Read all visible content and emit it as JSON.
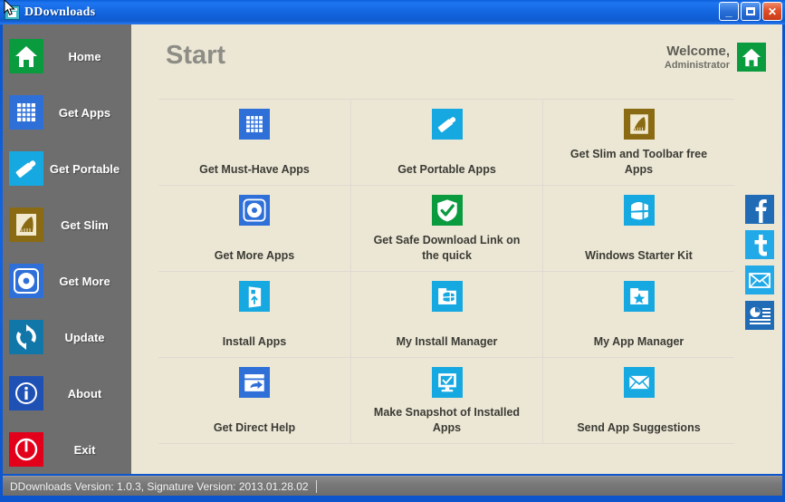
{
  "window": {
    "title": "DDownloads",
    "app_icon": "app-window-icon",
    "controls": [
      {
        "name": "minimize-button",
        "glyph": "_"
      },
      {
        "name": "maximize-button",
        "glyph": "□"
      },
      {
        "name": "close-button",
        "glyph": "✕"
      }
    ]
  },
  "sidebar": {
    "items": [
      {
        "label": "Home",
        "icon": "home-icon",
        "color": "#0a9b3f"
      },
      {
        "label": "Get Apps",
        "icon": "grid-apps-icon",
        "color": "#2f6fd8"
      },
      {
        "label": "Get Portable",
        "icon": "usb-stick-icon",
        "color": "#16a8e0"
      },
      {
        "label": "Get Slim",
        "icon": "slim-broom-icon",
        "color": "#8a6a12"
      },
      {
        "label": "Get More",
        "icon": "disc-icon",
        "color": "#2f6fd8"
      },
      {
        "label": "Update",
        "icon": "refresh-icon",
        "color": "#1176a8"
      },
      {
        "label": "About",
        "icon": "info-icon",
        "color": "#1f51b5"
      },
      {
        "label": "Exit",
        "icon": "power-icon",
        "color": "#e2001a"
      }
    ]
  },
  "header": {
    "page_title": "Start",
    "welcome_line1": "Welcome,",
    "welcome_line2": "Administrator",
    "welcome_icon": "home-icon"
  },
  "grid": {
    "rows": [
      [
        {
          "label": "Get Must-Have Apps",
          "icon": "grid-apps-icon",
          "color": "#2f6fd8"
        },
        {
          "label": "Get Portable Apps",
          "icon": "usb-stick-icon",
          "color": "#16a8e0"
        },
        {
          "label": "Get Slim and Toolbar free Apps",
          "icon": "slim-broom-icon",
          "color": "#8a6a12"
        }
      ],
      [
        {
          "label": "Get More Apps",
          "icon": "disc-icon",
          "color": "#2f6fd8"
        },
        {
          "label": "Get Safe Download Link on the quick",
          "icon": "shield-check-icon",
          "color": "#0a9b3f"
        },
        {
          "label": "Windows Starter Kit",
          "icon": "windows-flag-icon",
          "color": "#16a8e0"
        }
      ],
      [
        {
          "label": "Install Apps",
          "icon": "install-door-icon",
          "color": "#16a8e0"
        },
        {
          "label": "My Install Manager",
          "icon": "install-manager-icon",
          "color": "#16a8e0"
        },
        {
          "label": "My App Manager",
          "icon": "app-manager-star-icon",
          "color": "#16a8e0"
        }
      ],
      [
        {
          "label": "Get Direct Help",
          "icon": "help-folder-icon",
          "color": "#2f6fd8"
        },
        {
          "label": "Make Snapshot of Installed Apps",
          "icon": "monitor-check-icon",
          "color": "#16a8e0"
        },
        {
          "label": "Send App Suggestions",
          "icon": "mail-icon",
          "color": "#16a8e0"
        }
      ]
    ]
  },
  "social": {
    "items": [
      {
        "name": "facebook-icon",
        "color": "#1f6bb5"
      },
      {
        "name": "twitter-icon",
        "color": "#22aae8"
      },
      {
        "name": "email-icon",
        "color": "#22aae8"
      },
      {
        "name": "newsfeed-icon",
        "color": "#1f6bb5"
      }
    ]
  },
  "statusbar": {
    "text": "DDownloads Version: 1.0.3, Signature Version: 2013.01.28.02"
  }
}
